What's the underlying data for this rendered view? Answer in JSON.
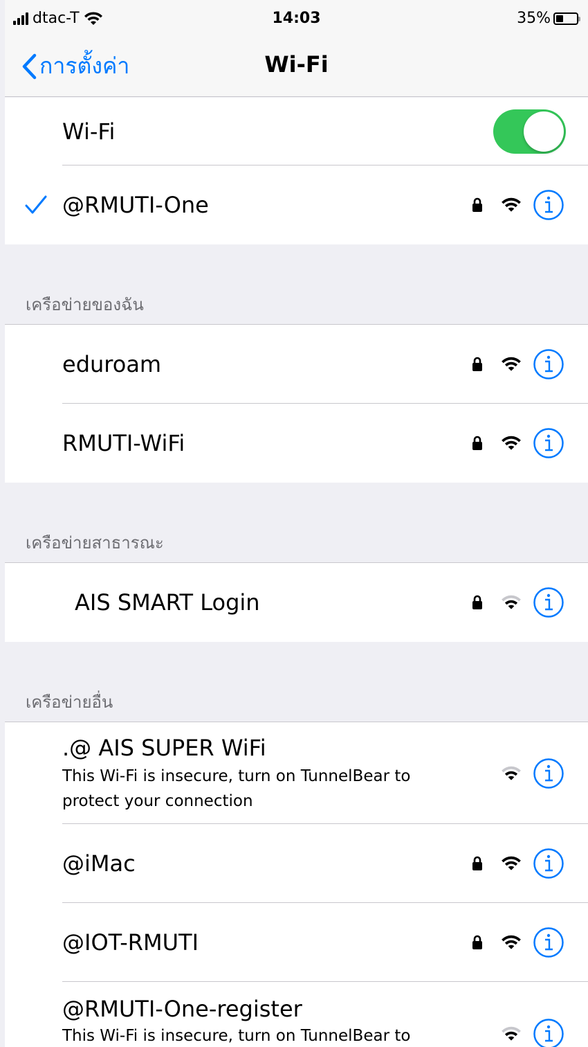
{
  "status_bar": {
    "carrier": "dtac-T",
    "time": "14:03",
    "battery": "35%",
    "battery_level": 0.35
  },
  "nav": {
    "back_label": "การตั้งค่า",
    "title": "Wi-Fi"
  },
  "wifi_toggle": {
    "label": "Wi-Fi",
    "state": "on"
  },
  "connected": {
    "name": "@RMUTI-One",
    "secured": true,
    "signal": "full"
  },
  "sections": {
    "my_networks": {
      "header": "เครือข่ายของฉัน",
      "items": [
        {
          "name": "eduroam",
          "secured": true,
          "signal": "full"
        },
        {
          "name": "RMUTI-WiFi",
          "secured": true,
          "signal": "full"
        }
      ]
    },
    "public_networks": {
      "header": "เครือข่ายสาธารณะ",
      "items": [
        {
          "name": "AIS SMART Login",
          "secured": true,
          "signal": "medium"
        }
      ]
    },
    "other_networks": {
      "header": "เครือข่ายอื่น",
      "items": [
        {
          "name": ".@ AIS SUPER WiFi",
          "subtitle": "This Wi-Fi is insecure, turn on TunnelBear to protect your connection",
          "secured": false,
          "signal": "medium"
        },
        {
          "name": "@iMac",
          "secured": true,
          "signal": "full"
        },
        {
          "name": "@IOT-RMUTI",
          "secured": true,
          "signal": "full"
        },
        {
          "name": "@RMUTI-One-register",
          "subtitle": "This Wi-Fi is insecure, turn on TunnelBear to",
          "secured": false,
          "signal": "medium"
        }
      ]
    }
  },
  "colors": {
    "accent": "#007aff",
    "toggle_on": "#34c759",
    "background": "#efeff4",
    "header_text": "#6d6d72",
    "separator": "#c8c7cc"
  },
  "icons": {
    "back": "chevron-left-icon",
    "check": "checkmark-icon",
    "lock": "lock-icon",
    "wifi": "wifi-icon",
    "info": "info-icon"
  }
}
